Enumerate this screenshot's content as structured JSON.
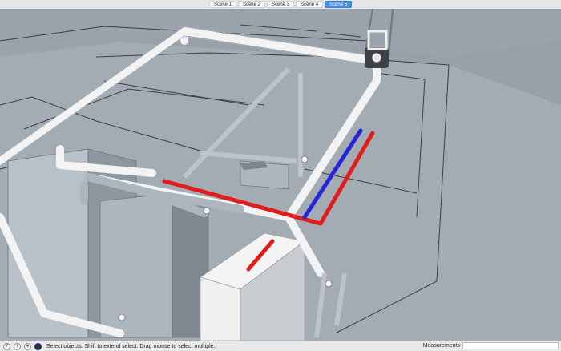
{
  "scenes": {
    "tabs": [
      "Scene 1",
      "Scene 2",
      "Scene 3",
      "Scene 4",
      "Scene 5"
    ],
    "active": "Scene 5"
  },
  "status": {
    "icons": [
      "help-icon",
      "info-icon",
      "user-icon",
      "select-tool-icon"
    ],
    "text": "Select objects. Shift to extend select. Drag mouse to select multiple.",
    "measurements_label": "Measurements",
    "measurements_value": ""
  },
  "colors": {
    "background": "#98a1aa",
    "pipe_white": "#f2f2f2",
    "pipe_red": "#e21b1b",
    "pipe_blue": "#2424d8"
  }
}
